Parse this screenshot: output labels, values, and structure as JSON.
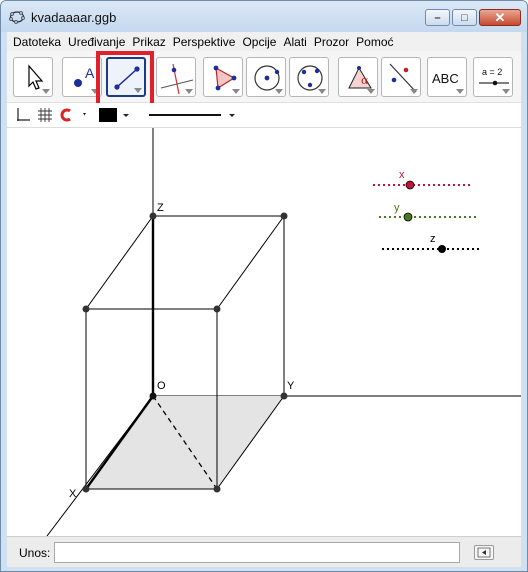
{
  "window": {
    "title": "kvadaaaar.ggb",
    "controls": {
      "minimize": "–",
      "maximize": "□",
      "close": "✕"
    }
  },
  "menu": [
    "Datoteka",
    "Uređivanje",
    "Prikaz",
    "Perspektive",
    "Opcije",
    "Alati",
    "Prozor",
    "Pomoć"
  ],
  "toolbar": {
    "tools": [
      {
        "name": "move-tool",
        "icon": "arrow-pointer-icon"
      },
      {
        "name": "point-tool",
        "icon": "point-A-icon",
        "label": "A"
      },
      {
        "name": "segment-tool",
        "icon": "segment-icon",
        "selected": true
      },
      {
        "name": "perpendicular-line-tool",
        "icon": "perpendicular-line-icon"
      },
      {
        "name": "polygon-tool",
        "icon": "polygon-icon"
      },
      {
        "name": "circle-center-point-tool",
        "icon": "circle-center-icon"
      },
      {
        "name": "circle-three-points-tool",
        "icon": "circle-three-points-icon"
      },
      {
        "name": "angle-tool",
        "icon": "angle-icon",
        "label": "α"
      },
      {
        "name": "reflect-tool",
        "icon": "reflect-line-icon"
      },
      {
        "name": "text-tool",
        "icon": "text-icon",
        "label": "ABC"
      },
      {
        "name": "slider-tool",
        "icon": "slider-icon",
        "label": "a = 2"
      }
    ],
    "highlight_color": "#e0202a"
  },
  "stylebar": {
    "color_swatch": "#000000"
  },
  "graphics": {
    "points": {
      "Z": "Z",
      "O": "O",
      "Y": "Y",
      "X": "X"
    },
    "sliders": [
      {
        "label": "x",
        "color": "#c0143c"
      },
      {
        "label": "y",
        "color": "#4a7a1e"
      },
      {
        "label": "z",
        "color": "#000000"
      }
    ],
    "base_fill": "#e4e4e4"
  },
  "inputbar": {
    "label": "Unos:",
    "value": ""
  }
}
